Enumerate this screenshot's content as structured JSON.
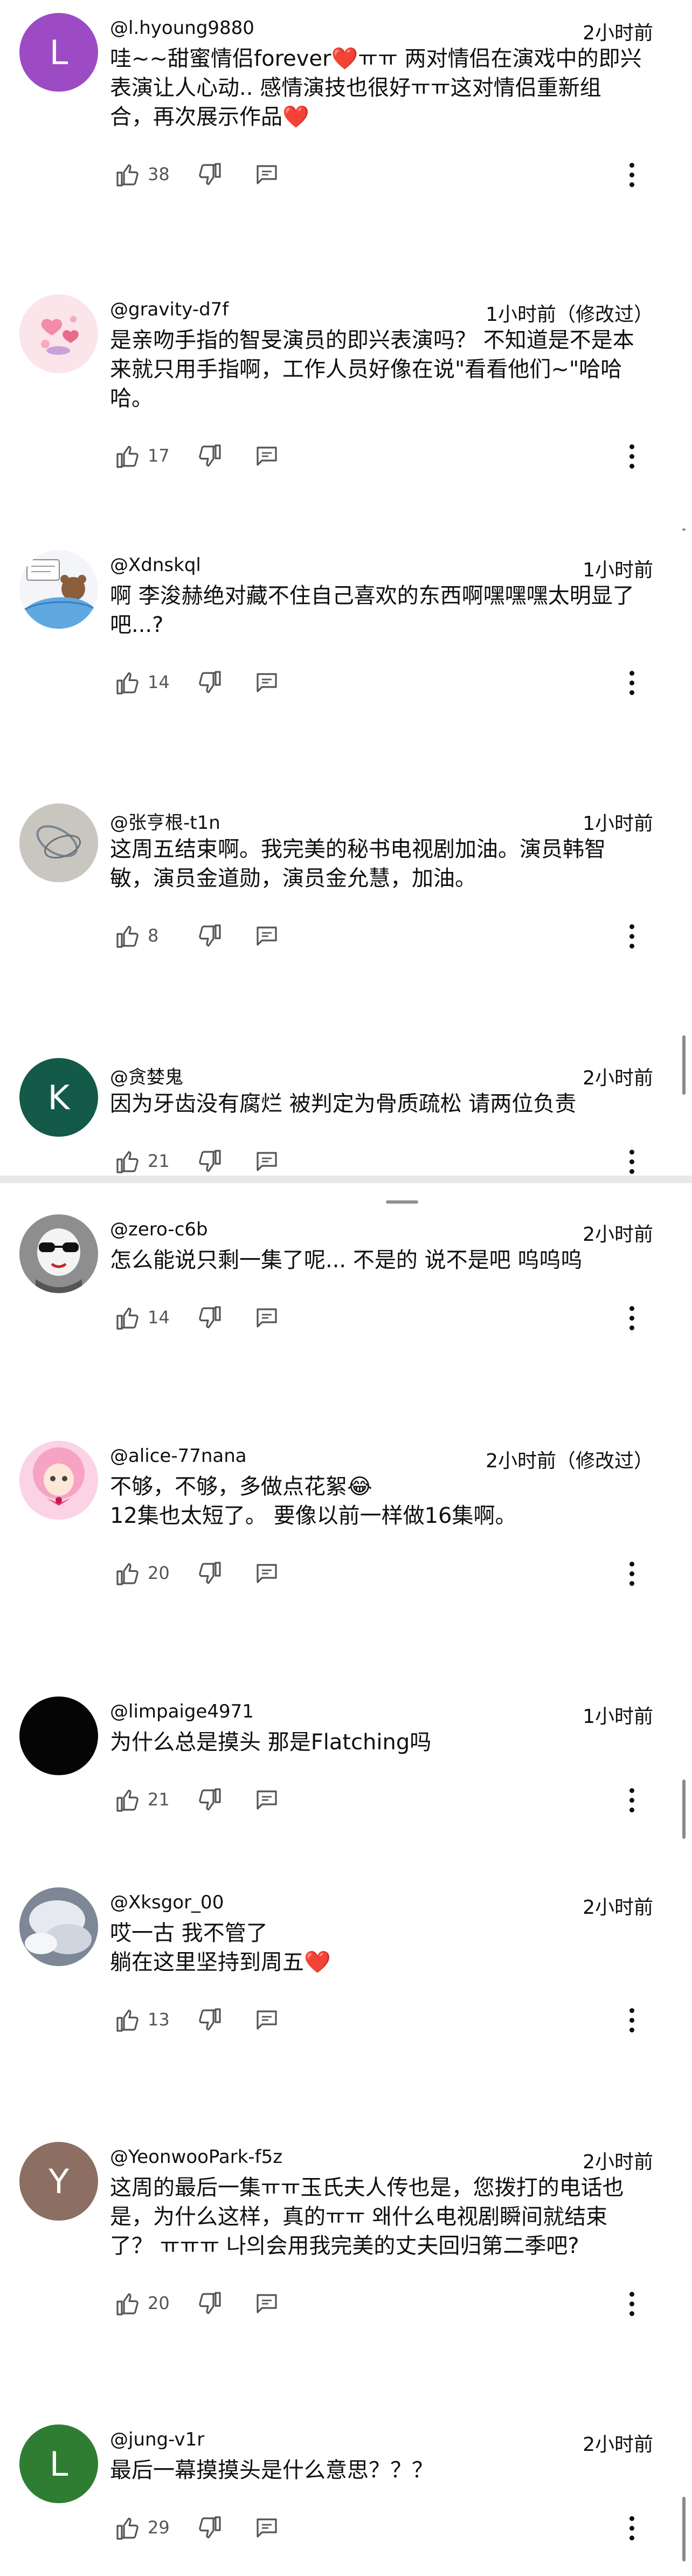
{
  "comments": [
    {
      "handle": "@l.hyoung9880",
      "time": "2小时前",
      "text": "哇~~甜蜜情侣forever❤️ㅠㅠ 两对情侣在演戏中的即兴\n表演让人心动.. 感情演技也很好ㅠㅠ这对情侣重新组\n合，再次展示作品❤️",
      "likes": "38",
      "avatar": {
        "initial": "L",
        "color": "#9c4bc4"
      }
    },
    {
      "handle": "@gravity-d7f",
      "time": "1小时前（修改过）",
      "text": "是亲吻手指的智旻演员的即兴表演吗？ 不知道是不是本\n来就只用手指啊，工作人员好像在说\"看看他们~\"哈哈\n哈。",
      "likes": "17",
      "avatar": {
        "initial": "",
        "color": "#f6d6df"
      }
    },
    {
      "handle": "@Xdnskql",
      "time": "1小时前",
      "text": "啊 李浚赫绝对藏不住自己喜欢的东西啊嘿嘿嘿太明显了\n吧...?",
      "likes": "14",
      "avatar": {
        "initial": "",
        "color": "#eef2f6"
      }
    },
    {
      "handle": "@张亨根-t1n",
      "time": "1小时前",
      "text": "这周五结束啊。我完美的秘书电视剧加油。演员韩智\n敏，演员金道勋，演员金允慧，加油。",
      "likes": "8",
      "avatar": {
        "initial": "",
        "color": "#b8b4ae"
      }
    },
    {
      "handle": "@贪婪鬼",
      "time": "2小时前",
      "text": "因为牙齿没有腐烂 被判定为骨质疏松 请两位负责",
      "likes": "21",
      "avatar": {
        "initial": "K",
        "color": "#145a48"
      }
    },
    {
      "handle": "@zero-c6b",
      "time": "2小时前",
      "text": "怎么能说只剩一集了呢... 不是的 说不是吧 呜呜呜",
      "likes": "14",
      "avatar": {
        "initial": "",
        "color": "#9a9a9a"
      }
    },
    {
      "handle": "@alice-77nana",
      "time": "2小时前（修改过）",
      "text": "不够，不够，多做点花絮😂\n12集也太短了。 要像以前一样做16集啊。",
      "likes": "20",
      "avatar": {
        "initial": "",
        "color": "#f4a6c8"
      }
    },
    {
      "handle": "@limpaige4971",
      "time": "1小时前",
      "text": "为什么总是摸头 那是Flatching吗",
      "likes": "21",
      "avatar": {
        "initial": "",
        "color": "#050505"
      }
    },
    {
      "handle": "@Xksgor_00",
      "time": "2小时前",
      "text": "哎一古 我不管了\n躺在这里坚持到周五❤️",
      "likes": "13",
      "avatar": {
        "initial": "",
        "color": "#9ea6b3"
      }
    },
    {
      "handle": "@YeonwooPark-f5z",
      "time": "2小时前",
      "text": "这周的最后一集ㅠㅠ玉氏夫人传也是，您拨打的电话也\n是，为什么这样，真的ㅠㅠ 왜什么电视剧瞬间就结束\n了？ ㅠㅠㅠ 나의会用我完美的丈夫回归第二季吧?",
      "likes": "20",
      "avatar": {
        "initial": "Y",
        "color": "#8d6e63"
      }
    },
    {
      "handle": "@jung-v1r",
      "time": "2小时前",
      "text": "最后一幕摸摸头是什么意思？？？",
      "likes": "29",
      "avatar": {
        "initial": "L",
        "color": "#2e7d32"
      }
    }
  ]
}
